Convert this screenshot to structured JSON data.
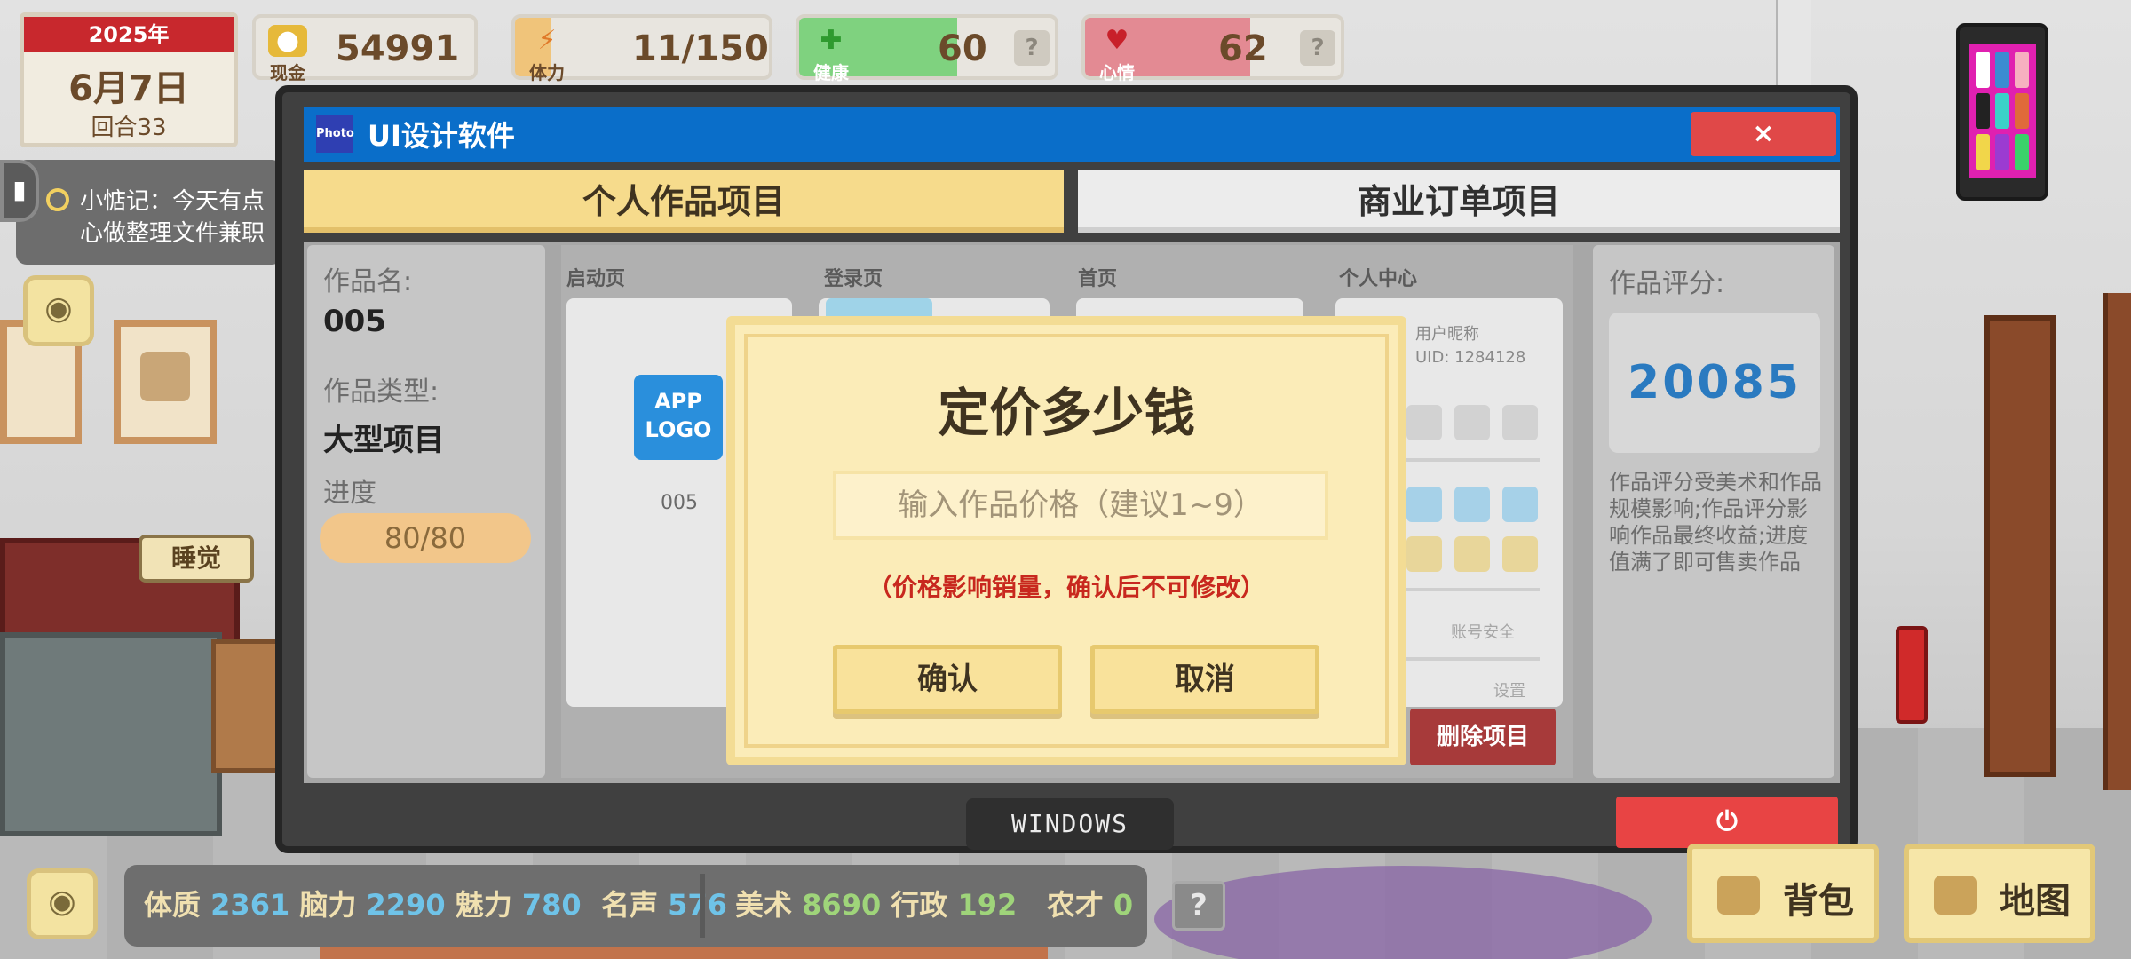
{
  "hud": {
    "calendar": {
      "year": "2025年",
      "date": "6月7日",
      "turn": "回合33"
    },
    "money": {
      "label": "现金",
      "value": "54991"
    },
    "stamina": {
      "label": "体力",
      "value": "11/150"
    },
    "health": {
      "label": "健康",
      "value": "60",
      "help": "?"
    },
    "mood": {
      "label": "心情",
      "value": "62",
      "help": "?"
    },
    "note": {
      "line1": "小惦记：今天有点",
      "line2": "心做整理文件兼职"
    },
    "sleep_bubble": "睡觉"
  },
  "window": {
    "logo_text": "Photo",
    "title": "UI设计软件",
    "close": "×",
    "tabs": [
      "个人作品项目",
      "商业订单项目"
    ],
    "info": {
      "name_label": "作品名:",
      "name_value": "005",
      "type_label": "作品类型:",
      "type_value": "大型项目",
      "progress_label": "进度",
      "progress_value": "80/80",
      "progress_fraction": 1.0
    },
    "screens": [
      {
        "label": "启动页"
      },
      {
        "label": "登录页"
      },
      {
        "label": "首页"
      },
      {
        "label": "个人中心"
      }
    ],
    "splash": {
      "logo": "APP LOGO",
      "caption": "005"
    },
    "profile": {
      "nickname": "用户昵称",
      "uid": "UID: 1284128",
      "account_security": "账号安全",
      "settings": "设置"
    },
    "delete_button": "删除项目",
    "score": {
      "label": "作品评分:",
      "value": "20085",
      "desc": "作品评分受美术和作品规模影响;作品评分影响作品最终收益;进度值满了即可售卖作品"
    },
    "taskbar": "WINDOWS",
    "power": "⏻"
  },
  "dialog": {
    "title": "定价多少钱",
    "input_placeholder": "输入作品价格（建议1~9）",
    "input_value": "",
    "warning": "（价格影响销量，确认后不可修改）",
    "confirm": "确认",
    "cancel": "取消"
  },
  "bottom": {
    "attrs1": [
      {
        "name": "体质",
        "value": "2361"
      },
      {
        "name": "脑力",
        "value": "2290"
      },
      {
        "name": "魅力",
        "value": "780"
      },
      {
        "name": "名声",
        "value": "576"
      }
    ],
    "attrs2": [
      {
        "name": "美术",
        "value": "8690"
      },
      {
        "name": "行政",
        "value": "192"
      },
      {
        "name": "农才",
        "value": "0"
      }
    ],
    "help": "?",
    "backpack": "背包",
    "map": "地图"
  },
  "colors": {
    "title_blue": "#0a6ec9",
    "tab_active": "#f6db8c",
    "dialog_bg": "#fbecb8",
    "warning_red": "#c8281e",
    "score_blue": "#2a7ac0",
    "health_green": "#5fc45f",
    "mood_red": "#e04d5a"
  }
}
